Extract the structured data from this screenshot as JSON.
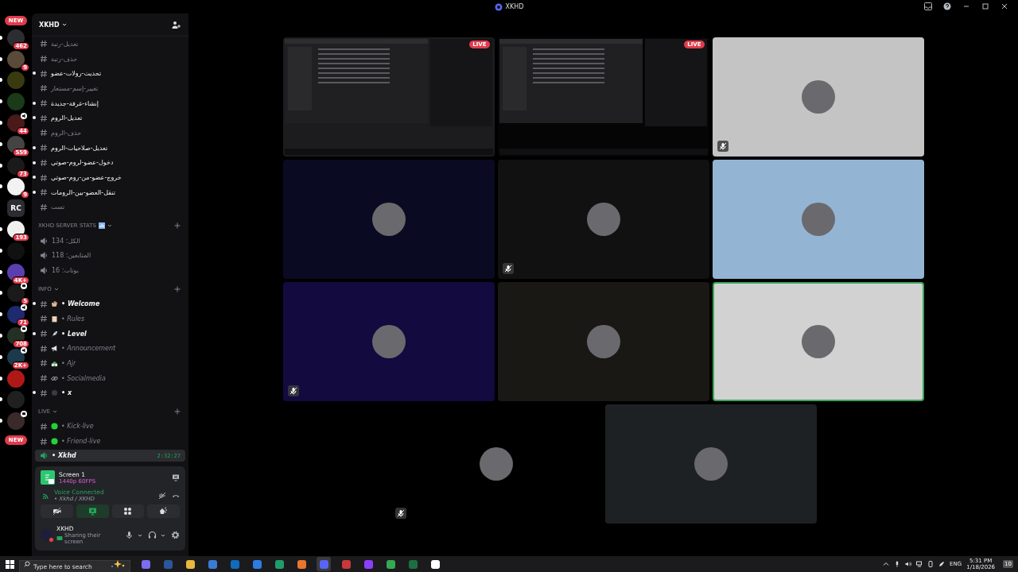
{
  "window": {
    "title": "XKHD"
  },
  "rail": {
    "top_badge": "NEW",
    "bottom_badge": "NEW",
    "servers": [
      {
        "badge": "462",
        "unread": true
      },
      {
        "badge": "9",
        "unread": true
      },
      {
        "unread": true
      },
      {
        "unread": true
      },
      {
        "badge": "44",
        "unread": true,
        "kind": "voice"
      },
      {
        "badge": "559",
        "unread": true
      },
      {
        "badge": "73",
        "unread": true
      },
      {
        "badge": "9",
        "unread": true
      },
      {
        "label": "RC",
        "unread": false
      },
      {
        "badge": "193",
        "unread": true
      },
      {
        "unread": true
      },
      {
        "badge": "4K+",
        "unread": true
      },
      {
        "badge": "5",
        "unread": true,
        "kind": "chat"
      },
      {
        "badge": "71",
        "unread": true,
        "kind": "voice"
      },
      {
        "badge": "708",
        "unread": true,
        "kind": "chat"
      },
      {
        "badge": "2K+",
        "unread": true,
        "kind": "voice"
      },
      {
        "unread": true
      },
      {
        "unread": true
      },
      {
        "unread": true,
        "kind": "chat"
      }
    ]
  },
  "server": {
    "name": "XKHD"
  },
  "channels": [
    {
      "name": "تعديل-رتبة",
      "unread": false
    },
    {
      "name": "حذف-رتبة",
      "unread": false
    },
    {
      "name": "تحديث-رولات-عضو",
      "unread": true
    },
    {
      "name": "تغيير-إسم-مستعار",
      "unread": false
    },
    {
      "name": "إنشاء-غرفة-جديدة",
      "unread": true
    },
    {
      "name": "تعديل-الروم",
      "unread": true
    },
    {
      "name": "حذف-الروم",
      "unread": false
    },
    {
      "name": "تعديل-صلاحيات-الروم",
      "unread": true
    },
    {
      "name": "دخول-عضو-لروم-صوتي",
      "unread": true
    },
    {
      "name": "خروج-عضو-من-روم-صوتي",
      "unread": true
    },
    {
      "name": "تنقل-العضو-بين-الرومات",
      "unread": true
    },
    {
      "name": "تست",
      "unread": false
    }
  ],
  "categories": [
    {
      "name": "XKHD SERVER STATS",
      "kind": "stats",
      "channels": [
        {
          "name": "الكل: 134"
        },
        {
          "name": "المتابعين: 118"
        },
        {
          "name": "بوتات: 16"
        }
      ]
    },
    {
      "name": "INFO",
      "kind": "text",
      "channels": [
        {
          "name": "• Welcome",
          "unread": true
        },
        {
          "name": "• Rules",
          "unread": false
        },
        {
          "name": "• Level",
          "unread": true
        },
        {
          "name": "• Announcement",
          "unread": false
        },
        {
          "name": "• Ajr",
          "unread": false
        },
        {
          "name": "• Socialmedia",
          "unread": false
        },
        {
          "name": "• x",
          "unread": true
        }
      ]
    },
    {
      "name": "LIVE",
      "kind": "live",
      "channels": [
        {
          "name": "• Kick-live",
          "unread": false
        },
        {
          "name": "• Friend-live",
          "unread": false
        }
      ]
    }
  ],
  "voice_channel": {
    "name": "• Xkhd",
    "time": "2:32:27"
  },
  "stream": {
    "title": "Screen 1",
    "quality": "1440p 60FPS"
  },
  "voice": {
    "status": "Voice Connected",
    "location": "• Xkhd / XKHD"
  },
  "user": {
    "name": "XKHD",
    "status": "Sharing their screen"
  },
  "tiles": [
    {
      "kind": "screen",
      "live": "LIVE",
      "muted": false,
      "speaking": false,
      "color": "#1c1c1e"
    },
    {
      "kind": "screen",
      "live": "LIVE",
      "muted": false,
      "speaking": false,
      "color": "#050505"
    },
    {
      "kind": "avatar",
      "muted": true,
      "speaking": false,
      "color": "#c4c4c4"
    },
    {
      "kind": "avatar",
      "muted": false,
      "speaking": false,
      "color": "#0a0b22"
    },
    {
      "kind": "avatar",
      "muted": true,
      "speaking": false,
      "color": "#111111"
    },
    {
      "kind": "avatar",
      "muted": false,
      "speaking": false,
      "color": "#94b4d4"
    },
    {
      "kind": "avatar",
      "muted": true,
      "speaking": false,
      "color": "#130a40"
    },
    {
      "kind": "avatar",
      "muted": false,
      "speaking": false,
      "color": "#1a1814"
    },
    {
      "kind": "avatar",
      "muted": false,
      "speaking": true,
      "color": "#d2d2d2"
    },
    {
      "kind": "avatar",
      "muted": true,
      "speaking": false,
      "color": "#000000"
    },
    {
      "kind": "avatar",
      "muted": false,
      "speaking": false,
      "color": "#1e2124"
    }
  ],
  "taskbar": {
    "search": {
      "placeholder": "Type here to search"
    },
    "language": "ENG",
    "time": "5:31 PM",
    "date": "1/18/2026",
    "notifications": "10"
  }
}
